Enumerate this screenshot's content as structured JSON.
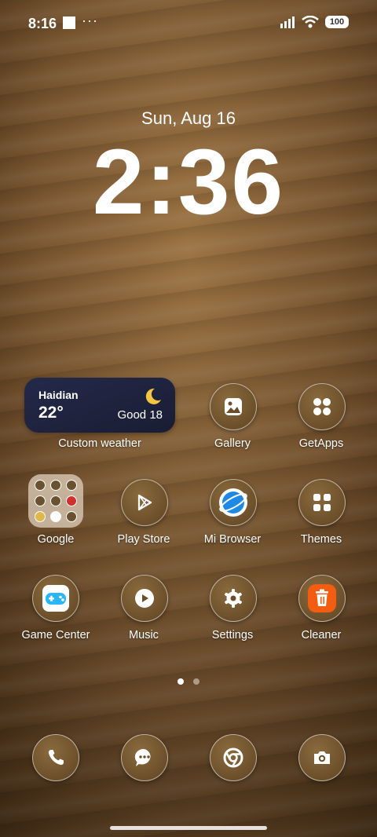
{
  "status_bar": {
    "time": "8:16",
    "dots": "···",
    "battery": "100",
    "icons": [
      "signal-icon",
      "wifi-icon",
      "battery-icon"
    ]
  },
  "lockscreen_clock": {
    "date": "Sun, Aug 16",
    "time": "2:36"
  },
  "weather_widget": {
    "city": "Haidian",
    "temperature": "22°",
    "air_quality": "Good 18",
    "icon": "moon-icon",
    "label": "Custom weather"
  },
  "apps_row1": [
    {
      "label": "Gallery",
      "icon": "gallery-icon"
    },
    {
      "label": "GetApps",
      "icon": "getapps-icon"
    }
  ],
  "apps_row2": [
    {
      "label": "Google",
      "icon": "folder-icon"
    },
    {
      "label": "Play Store",
      "icon": "play-store-icon"
    },
    {
      "label": "Mi Browser",
      "icon": "browser-icon"
    },
    {
      "label": "Themes",
      "icon": "themes-icon"
    }
  ],
  "apps_row3": [
    {
      "label": "Game Center",
      "icon": "game-center-icon"
    },
    {
      "label": "Music",
      "icon": "music-icon"
    },
    {
      "label": "Settings",
      "icon": "gear-icon"
    },
    {
      "label": "Cleaner",
      "icon": "trash-icon"
    }
  ],
  "dock": [
    {
      "name": "Phone",
      "icon": "phone-icon"
    },
    {
      "name": "Messages",
      "icon": "message-icon"
    },
    {
      "name": "Chrome",
      "icon": "chrome-icon"
    },
    {
      "name": "Camera",
      "icon": "camera-icon"
    }
  ],
  "pager": {
    "pages": 2,
    "active": 1
  },
  "colors": {
    "weather_bg": "#1f2340",
    "cleaner_orange": "#f25d12",
    "browser_blue": "#1e88e5",
    "game_blue": "#29b6f6"
  }
}
